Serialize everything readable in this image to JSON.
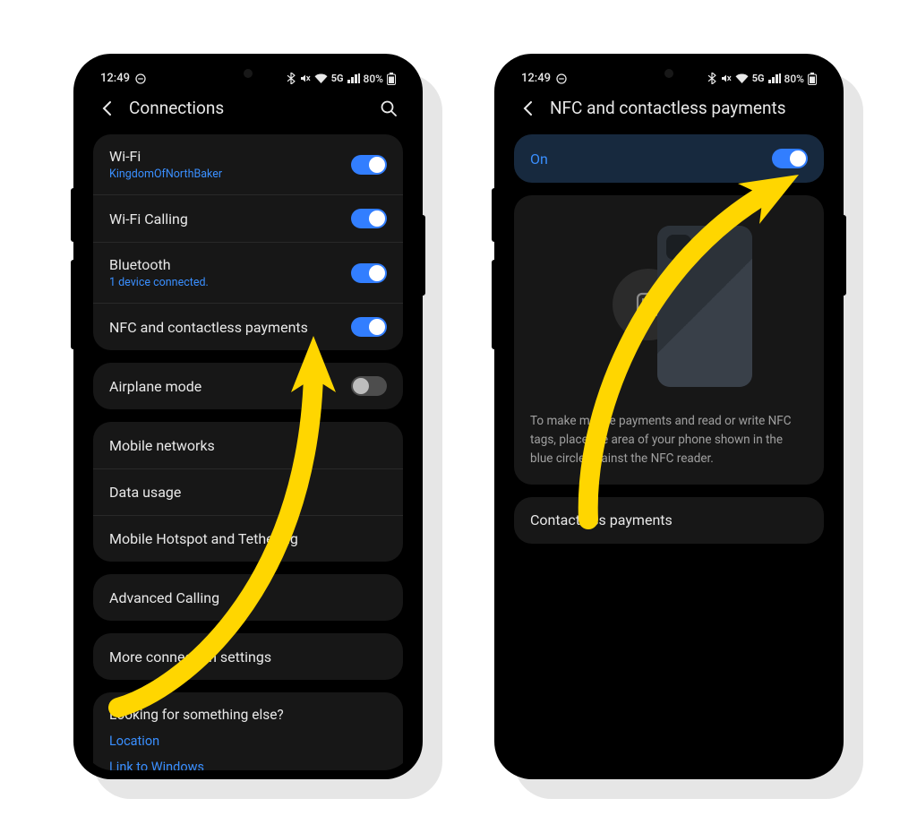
{
  "status": {
    "time": "12:49",
    "network": "5G",
    "signal": 4,
    "battery_pct": "80%"
  },
  "phone1": {
    "header_title": "Connections",
    "rows": {
      "wifi": {
        "label": "Wi-Fi",
        "sub": "KingdomOfNorthBaker",
        "toggle": "on"
      },
      "wifi_call": {
        "label": "Wi-Fi Calling",
        "toggle": "on"
      },
      "bluetooth": {
        "label": "Bluetooth",
        "sub": "1 device connected.",
        "toggle": "on"
      },
      "nfc": {
        "label": "NFC and contactless payments",
        "toggle": "on"
      },
      "airplane": {
        "label": "Airplane mode",
        "toggle": "off"
      },
      "mobile_net": {
        "label": "Mobile networks"
      },
      "data_usage": {
        "label": "Data usage"
      },
      "hotspot": {
        "label": "Mobile Hotspot and Tethering"
      },
      "adv_call": {
        "label": "Advanced Calling"
      },
      "more_conn": {
        "label": "More connection settings"
      }
    },
    "looking": {
      "question": "Looking for something else?",
      "links": [
        "Location",
        "Link to Windows"
      ]
    }
  },
  "phone2": {
    "header_title": "NFC and contactless payments",
    "on_label": "On",
    "on_toggle": "on",
    "nfc_glyph": "ℕ",
    "description": "To make mobile payments and read or write NFC tags, place the area of your phone shown in the blue circle against the NFC reader.",
    "contactless_label": "Contactless payments"
  }
}
